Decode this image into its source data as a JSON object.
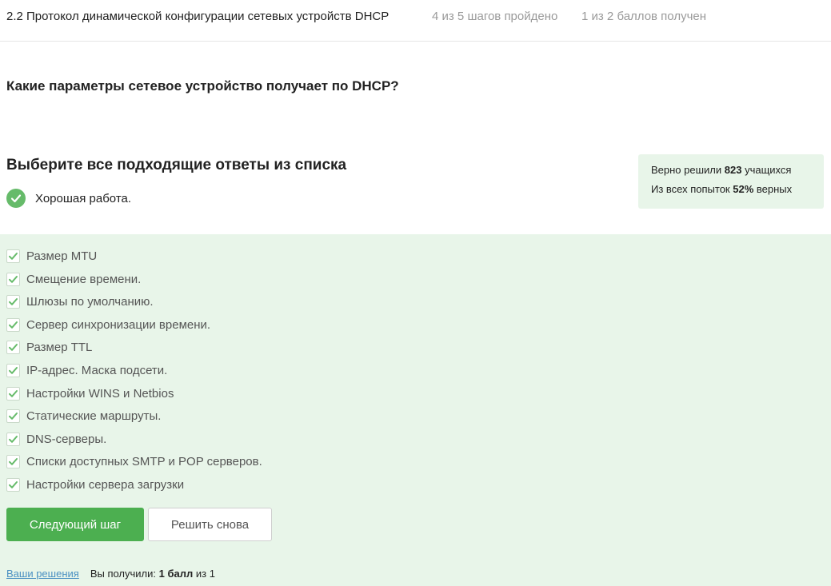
{
  "header": {
    "lesson_title": "2.2 Протокол динамической конфигурации сетевых устройств DHCP",
    "progress": "4 из 5 шагов пройдено",
    "score": "1 из 2 баллов  получен"
  },
  "question": "Какие параметры сетевое устройство получает по DHCP?",
  "instruction": "Выберите все подходящие ответы из списка",
  "feedback": {
    "icon": "check-circle-icon",
    "text": "Хорошая работа."
  },
  "stats": {
    "solved_prefix": "Верно решили ",
    "solved_count": "823",
    "solved_suffix": " учащихся",
    "attempts_prefix": "Из всех попыток ",
    "attempts_percent": "52%",
    "attempts_suffix": " верных"
  },
  "options": [
    {
      "label": "Размер MTU",
      "checked": true
    },
    {
      "label": "Смещение времени.",
      "checked": true
    },
    {
      "label": "Шлюзы по умолчанию.",
      "checked": true
    },
    {
      "label": "Сервер синхронизации времени.",
      "checked": true
    },
    {
      "label": "Размер TTL",
      "checked": true
    },
    {
      "label": "IP-адрес. Маска подсети.",
      "checked": true
    },
    {
      "label": "Настройки WINS и Netbios",
      "checked": true
    },
    {
      "label": "Статические маршруты.",
      "checked": true
    },
    {
      "label": "DNS-серверы.",
      "checked": true
    },
    {
      "label": "Списки доступных SMTP и POP серверов.",
      "checked": true
    },
    {
      "label": "Настройки сервера загрузки",
      "checked": true
    }
  ],
  "buttons": {
    "next": "Следующий шаг",
    "retry": "Решить снова"
  },
  "footer": {
    "solutions_link": "Ваши решения",
    "result_prefix": "Вы получили: ",
    "result_points": "1 балл",
    "result_suffix": " из 1"
  },
  "colors": {
    "accent_green": "#4caf50",
    "panel_green": "#e8f5e9",
    "link_blue": "#4a90c2"
  }
}
